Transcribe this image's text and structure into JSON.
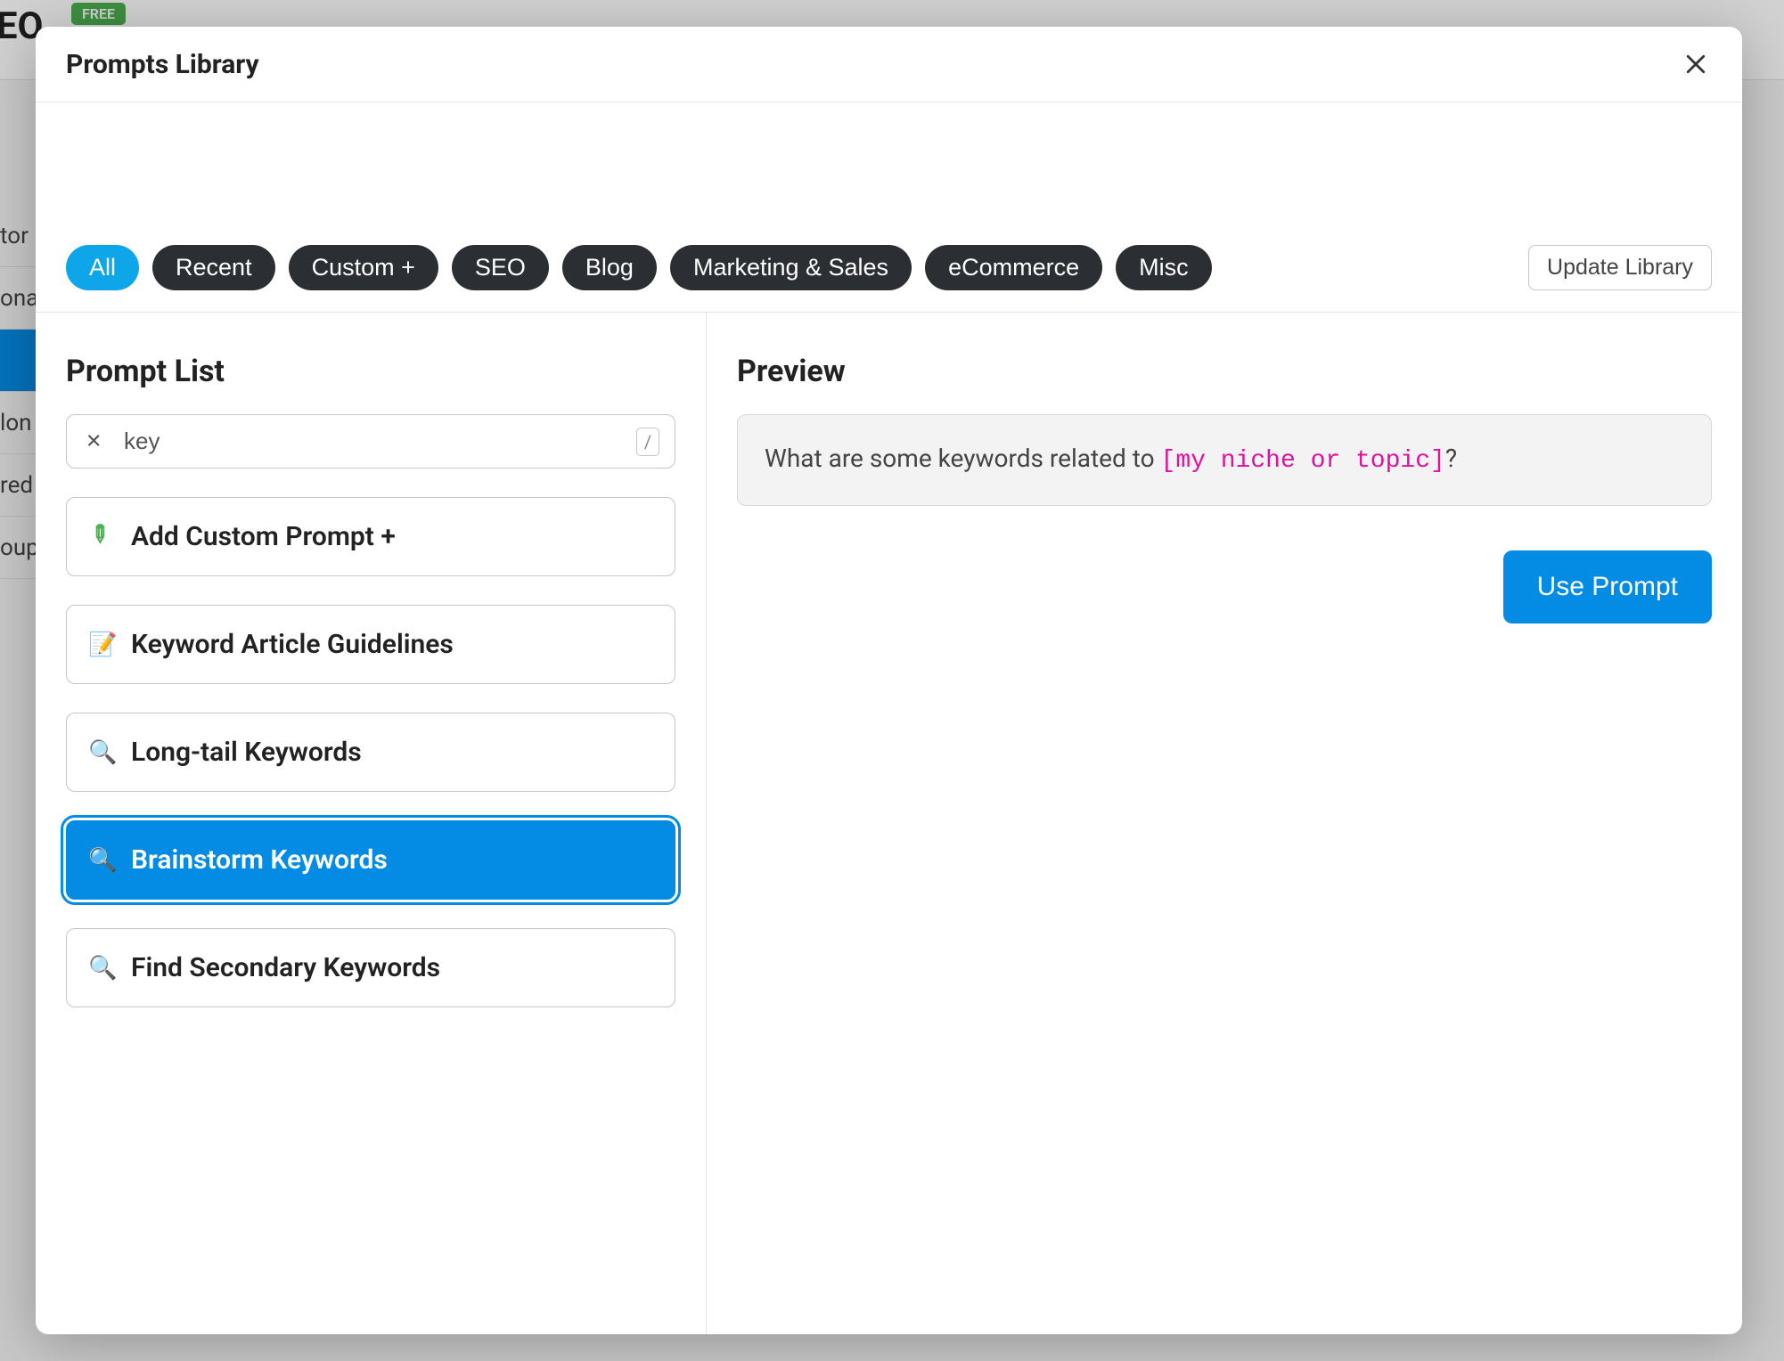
{
  "bg": {
    "seo_label": "SEO",
    "free_badge": "FREE",
    "sidebar_items": [
      "tor",
      "ona",
      "",
      "lon",
      "red",
      "oup"
    ]
  },
  "modal": {
    "title": "Prompts Library",
    "update_library": "Update Library",
    "filters": [
      {
        "label": "All",
        "active": true
      },
      {
        "label": "Recent",
        "active": false
      },
      {
        "label": "Custom +",
        "active": false
      },
      {
        "label": "SEO",
        "active": false
      },
      {
        "label": "Blog",
        "active": false
      },
      {
        "label": "Marketing & Sales",
        "active": false
      },
      {
        "label": "eCommerce",
        "active": false
      },
      {
        "label": "Misc",
        "active": false
      }
    ]
  },
  "left": {
    "title": "Prompt List",
    "search_value": "key",
    "slash_hint": "/",
    "items": [
      {
        "icon": "✎",
        "icon_class": "pencil-icon",
        "label": "Add Custom Prompt +",
        "selected": false
      },
      {
        "icon": "📝",
        "icon_class": "",
        "label": "Keyword Article Guidelines",
        "selected": false
      },
      {
        "icon": "🔍",
        "icon_class": "",
        "label": "Long-tail Keywords",
        "selected": false
      },
      {
        "icon": "🔍",
        "icon_class": "",
        "label": "Brainstorm Keywords",
        "selected": true
      },
      {
        "icon": "🔍",
        "icon_class": "",
        "label": "Find Secondary Keywords",
        "selected": false
      }
    ]
  },
  "right": {
    "title": "Preview",
    "preview_prefix": "What are some keywords related to ",
    "preview_placeholder": "[my niche or topic]",
    "preview_suffix": "?",
    "use_prompt": "Use Prompt"
  }
}
